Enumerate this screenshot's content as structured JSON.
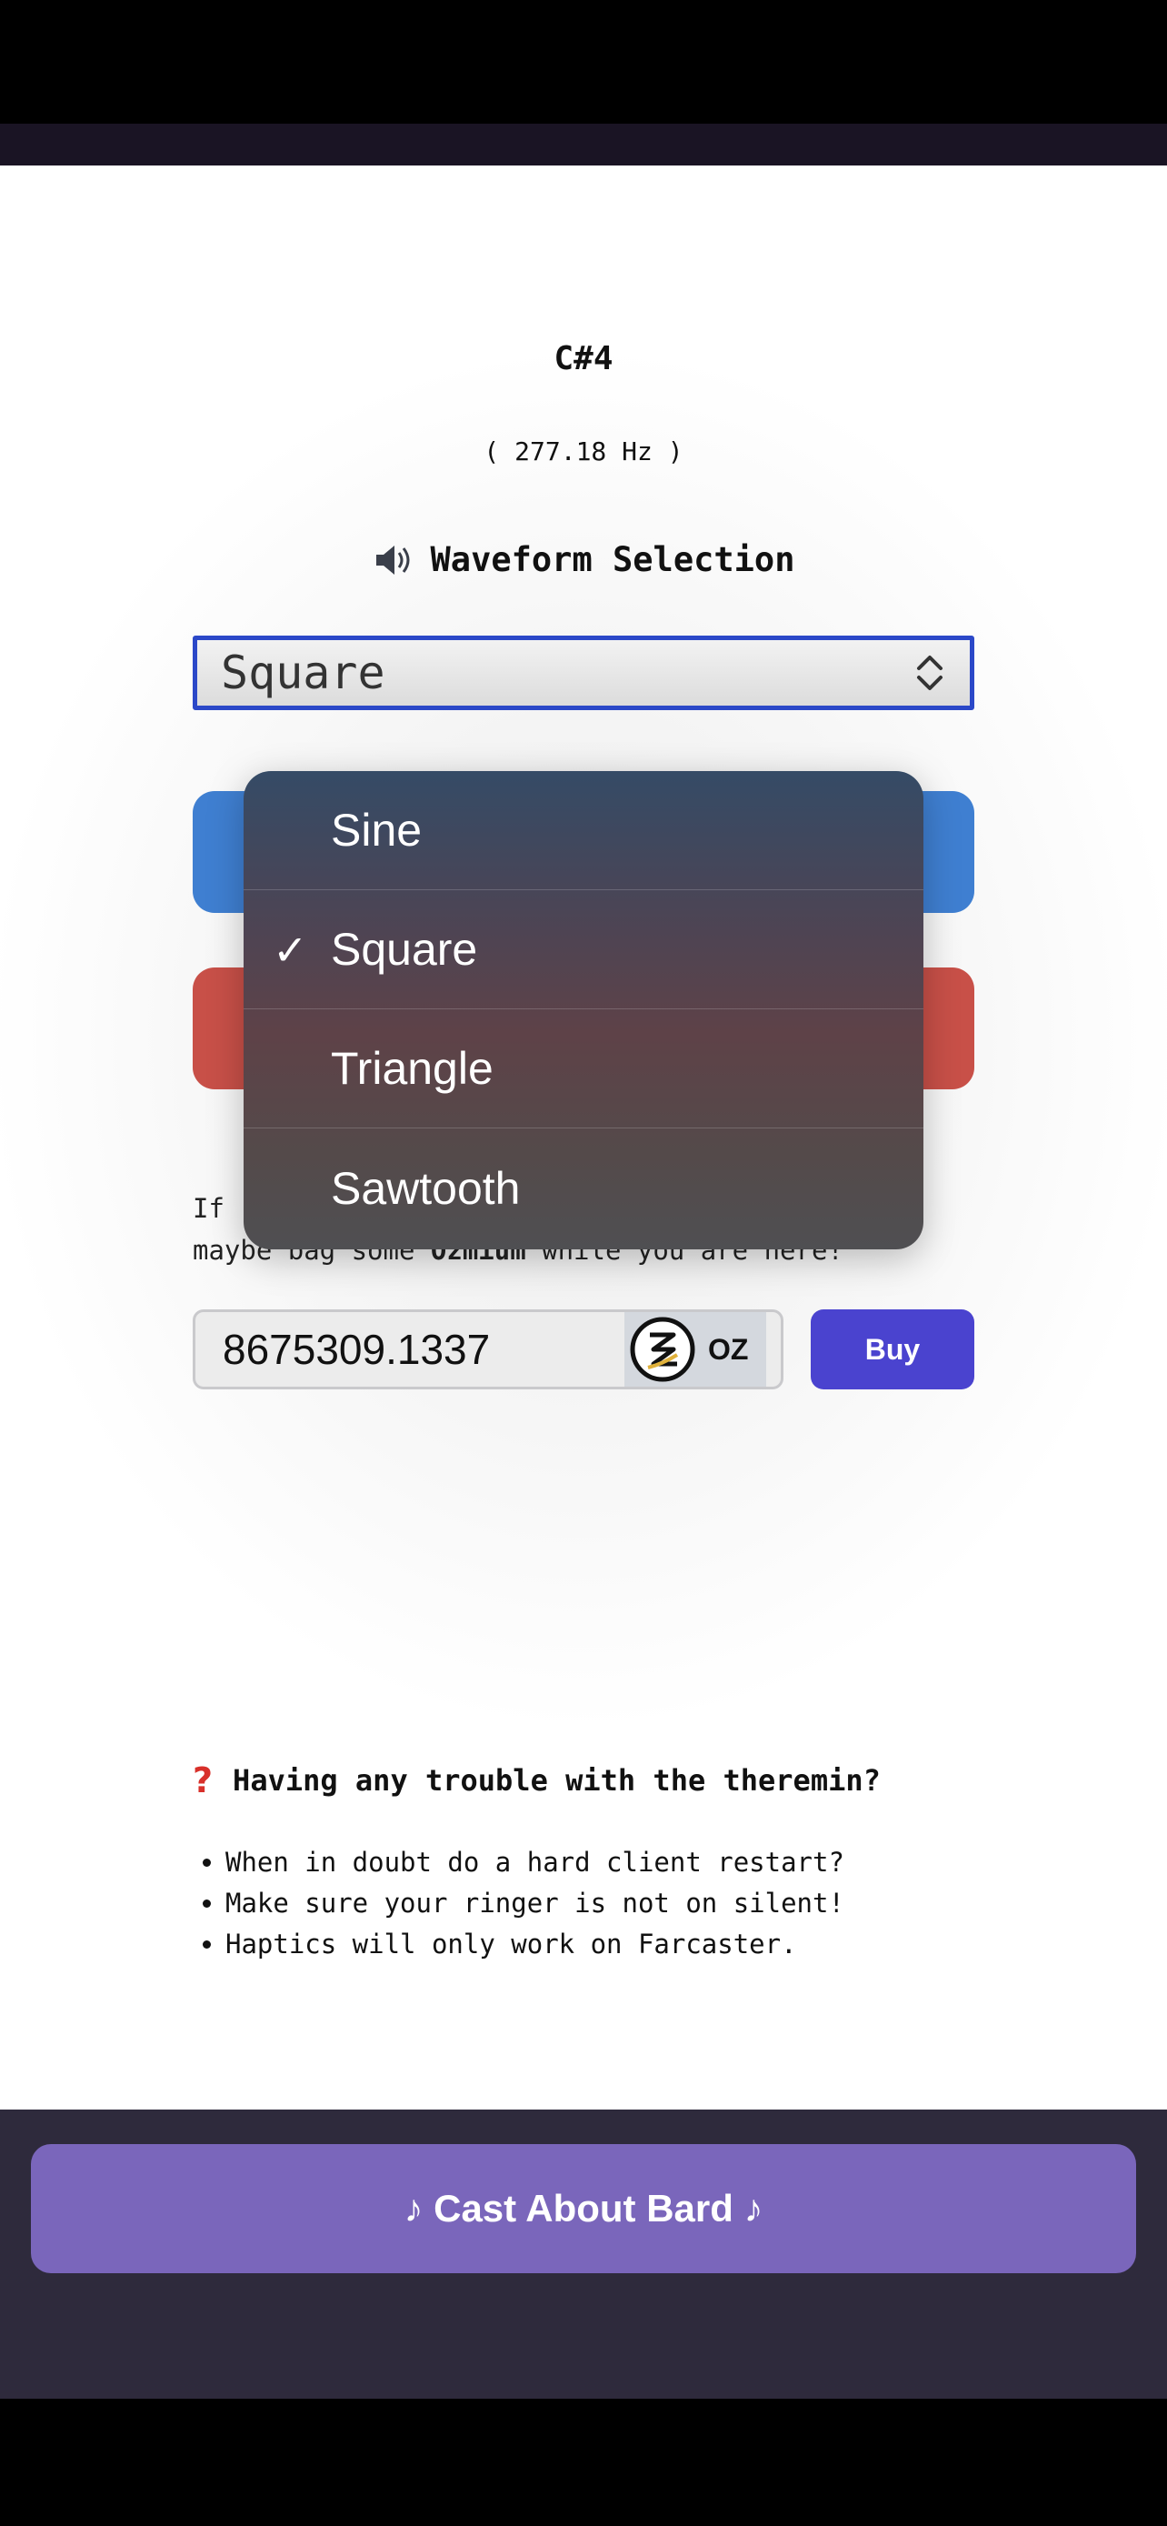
{
  "note": {
    "name": "C#4",
    "frequency": "( 277.18 Hz )"
  },
  "waveform": {
    "heading": "Waveform Selection",
    "selected": "Square",
    "options": [
      "Sine",
      "Square",
      "Triangle",
      "Sawtooth"
    ]
  },
  "info": {
    "line1": "If",
    "line2_before": "maybe bag some ",
    "line2_bold": "Ozmium",
    "line2_after": " while you are here!"
  },
  "purchase": {
    "amount": "8675309.1337",
    "token_symbol": "OZ",
    "buy_label": "Buy"
  },
  "help": {
    "title": "Having any trouble with the theremin?",
    "items": [
      "When in doubt do a hard client restart?",
      "Make sure your ringer is not on silent!",
      "Haptics will only work on Farcaster."
    ]
  },
  "footer": {
    "cast_label": "♪ Cast About Bard ♪"
  },
  "colors": {
    "accent": "#4a43cf",
    "cast": "#7a66bb",
    "blue_button": "#3f7fd1",
    "red_button": "#c85048",
    "select_border": "#2b48c8"
  },
  "icons": {
    "speaker": "speaker-icon",
    "question": "question-icon",
    "select_arrows": "updown-icon",
    "check": "checkmark-icon",
    "token": "ozmium-logo-icon"
  }
}
